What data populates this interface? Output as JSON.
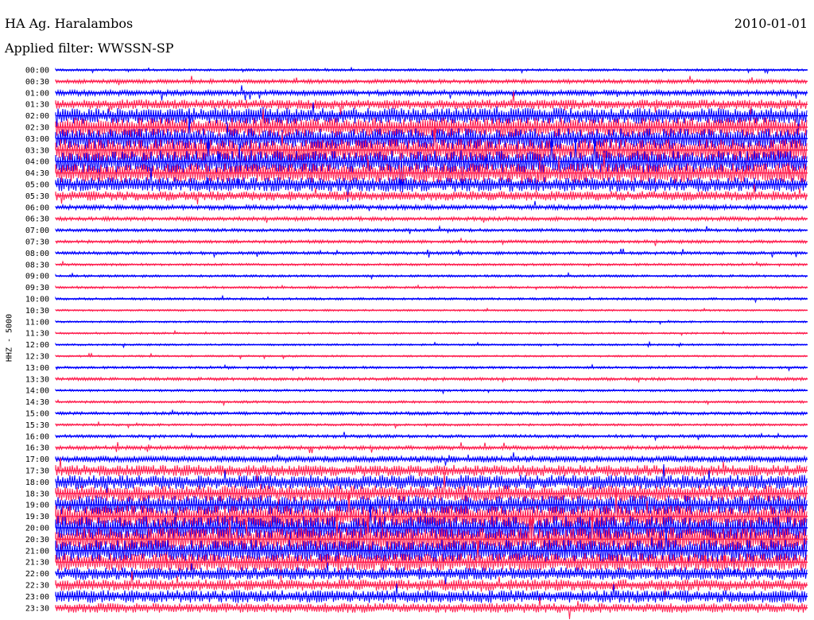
{
  "header": {
    "station": "HA Ag. Haralambos",
    "date": "2010-01-01",
    "filter": "Applied filter: WWSSN-SP"
  },
  "chart_data": {
    "type": "line",
    "chart_kind": "helicorder",
    "ylabel": "HHZ - 5000",
    "xlabel": "",
    "title": "",
    "grid": false,
    "colors": {
      "odd_rows": "#0000ff",
      "even_rows": "#ff2050"
    },
    "rows": [
      {
        "label": "00:00",
        "amplitude": 0.15
      },
      {
        "label": "00:30",
        "amplitude": 0.25
      },
      {
        "label": "01:00",
        "amplitude": 0.35
      },
      {
        "label": "01:30",
        "amplitude": 0.6
      },
      {
        "label": "02:00",
        "amplitude": 1.0
      },
      {
        "label": "02:30",
        "amplitude": 1.2
      },
      {
        "label": "03:00",
        "amplitude": 1.3
      },
      {
        "label": "03:30",
        "amplitude": 1.4
      },
      {
        "label": "04:00",
        "amplitude": 1.4
      },
      {
        "label": "04:30",
        "amplitude": 1.2
      },
      {
        "label": "05:00",
        "amplitude": 0.9
      },
      {
        "label": "05:30",
        "amplitude": 0.6
      },
      {
        "label": "06:00",
        "amplitude": 0.3
      },
      {
        "label": "06:30",
        "amplitude": 0.25
      },
      {
        "label": "07:00",
        "amplitude": 0.2
      },
      {
        "label": "07:30",
        "amplitude": 0.2
      },
      {
        "label": "08:00",
        "amplitude": 0.2
      },
      {
        "label": "08:30",
        "amplitude": 0.15
      },
      {
        "label": "09:00",
        "amplitude": 0.15
      },
      {
        "label": "09:30",
        "amplitude": 0.15
      },
      {
        "label": "10:00",
        "amplitude": 0.15
      },
      {
        "label": "10:30",
        "amplitude": 0.12
      },
      {
        "label": "11:00",
        "amplitude": 0.12
      },
      {
        "label": "11:30",
        "amplitude": 0.12
      },
      {
        "label": "12:00",
        "amplitude": 0.12
      },
      {
        "label": "12:30",
        "amplitude": 0.12
      },
      {
        "label": "13:00",
        "amplitude": 0.15
      },
      {
        "label": "13:30",
        "amplitude": 0.2
      },
      {
        "label": "14:00",
        "amplitude": 0.15
      },
      {
        "label": "14:30",
        "amplitude": 0.15
      },
      {
        "label": "15:00",
        "amplitude": 0.2
      },
      {
        "label": "15:30",
        "amplitude": 0.15
      },
      {
        "label": "16:00",
        "amplitude": 0.2
      },
      {
        "label": "16:30",
        "amplitude": 0.25
      },
      {
        "label": "17:00",
        "amplitude": 0.4
      },
      {
        "label": "17:30",
        "amplitude": 0.7
      },
      {
        "label": "18:00",
        "amplitude": 0.9
      },
      {
        "label": "18:30",
        "amplitude": 1.0
      },
      {
        "label": "19:00",
        "amplitude": 1.2
      },
      {
        "label": "19:30",
        "amplitude": 1.4
      },
      {
        "label": "20:00",
        "amplitude": 1.5
      },
      {
        "label": "20:30",
        "amplitude": 1.5
      },
      {
        "label": "21:00",
        "amplitude": 1.4
      },
      {
        "label": "21:30",
        "amplitude": 1.1
      },
      {
        "label": "22:00",
        "amplitude": 0.8
      },
      {
        "label": "22:30",
        "amplitude": 0.7
      },
      {
        "label": "23:00",
        "amplitude": 0.8
      },
      {
        "label": "23:30",
        "amplitude": 0.6
      }
    ]
  }
}
